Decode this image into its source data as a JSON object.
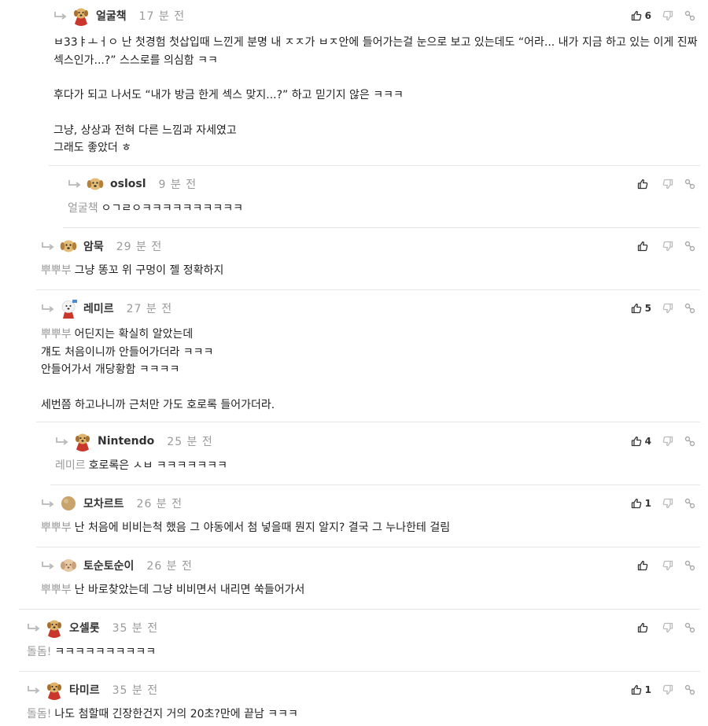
{
  "comments": [
    {
      "nick": "얼굴책",
      "time": "17 분 전",
      "likes": "6",
      "lines": [
        "ㅂ33ㅑㅗㅓㅇ 난 첫경험 첫삽입때 느낀게 분명 내 ㅈㅈ가 ㅂㅈ안에 들어가는걸 눈으로 보고 있는데도 “어라... 내가 지금 하고 있는 이게 진짜 섹스인가...?” 스스로를 의심함 ㅋㅋ",
        "",
        "후다가 되고 나서도 “내가 방금 한게 섹스 맞지...?” 하고 믿기지 않은 ㅋㅋㅋ",
        "",
        "그냥, 상상과 전혀 다른 느낌과 자세였고",
        "그래도 좋았더 ㅎ"
      ]
    },
    {
      "nick": "oslosl",
      "time": "9 분 전",
      "likes": "",
      "mention": "얼굴책",
      "lines": [
        "ㅇㄱㄹㅇㅋㅋㅋㅋㅋㅋㅋㅋㅋㅋ"
      ]
    },
    {
      "nick": "암묵",
      "time": "29 분 전",
      "likes": "",
      "mention": "뿌뿌부",
      "lines": [
        "그냥 똥꼬 위 구멍이 젤 정확하지"
      ]
    },
    {
      "nick": "레미르",
      "time": "27 분 전",
      "likes": "5",
      "mention": "뿌뿌부",
      "lines": [
        "어딘지는 확실히 알았는데",
        "걔도 처음이니까 안들어가더라 ㅋㅋㅋ",
        "안들어가서 개당황함 ㅋㅋㅋㅋ",
        "",
        "세번쯤 하고나니까 근처만 가도 호로록 들어가더라."
      ]
    },
    {
      "nick": "Nintendo",
      "time": "25 분 전",
      "likes": "4",
      "mention": "레미르",
      "lines": [
        "호로록은 ㅅㅂ ㅋㅋㅋㅋㅋㅋㅋ"
      ]
    },
    {
      "nick": "모차르트",
      "time": "26 분 전",
      "likes": "1",
      "mention": "뿌뿌부",
      "lines": [
        "난 처음에 비비는척 했음 그 야동에서 첨 넣을때 뭔지 알지? 결국 그 누나한테 걸림"
      ]
    },
    {
      "nick": "토순토순이",
      "time": "26 분 전",
      "likes": "",
      "mention": "뿌뿌부",
      "lines": [
        "난 바로찾았는데 그냥 비비면서 내리면 쑥들어가서"
      ]
    },
    {
      "nick": "오셀롯",
      "time": "35 분 전",
      "likes": "",
      "mention": "돌돔!",
      "lines": [
        "ㅋㅋㅋㅋㅋㅋㅋㅋㅋㅋ"
      ]
    },
    {
      "nick": "타미르",
      "time": "35 분 전",
      "likes": "1",
      "mention": "돌돔!",
      "lines": [
        "나도 첨할때 긴장한건지 거의 20초?만에 끝남 ㅋㅋㅋ"
      ]
    }
  ],
  "icons": {
    "reply": "reply-arrow-icon",
    "like": "thumbs-up-icon",
    "dislike": "thumbs-down-icon",
    "share": "link-icon"
  },
  "colors": {
    "muted": "#9a9a9a",
    "text": "#222222",
    "divider": "#e6e6e6"
  }
}
